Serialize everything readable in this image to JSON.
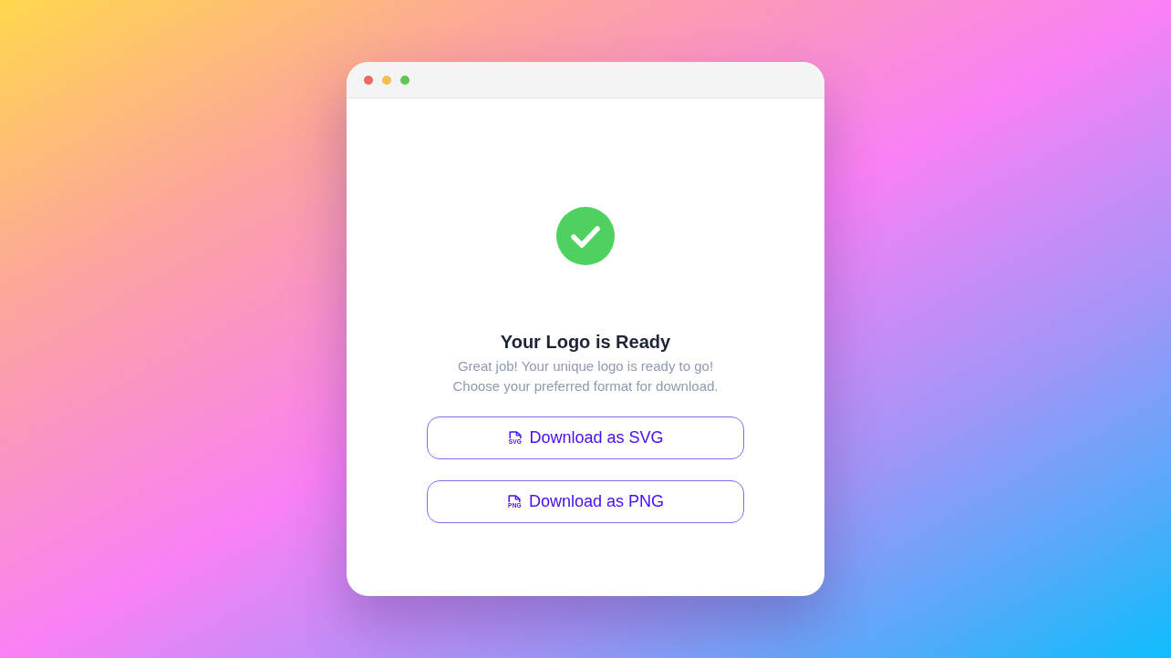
{
  "window": {
    "controls": [
      {
        "color": "#ec6a5e"
      },
      {
        "color": "#f4bf4f"
      },
      {
        "color": "#61c554"
      }
    ]
  },
  "title": "Your Logo is Ready",
  "message_lines": [
    "Great job! Your unique logo is ready to go!",
    "Choose your preferred format for download."
  ],
  "buttons": [
    {
      "label": "Download as SVG",
      "icon_text": "SVG"
    },
    {
      "label": "Download as PNG",
      "icon_text": "PNG"
    }
  ]
}
